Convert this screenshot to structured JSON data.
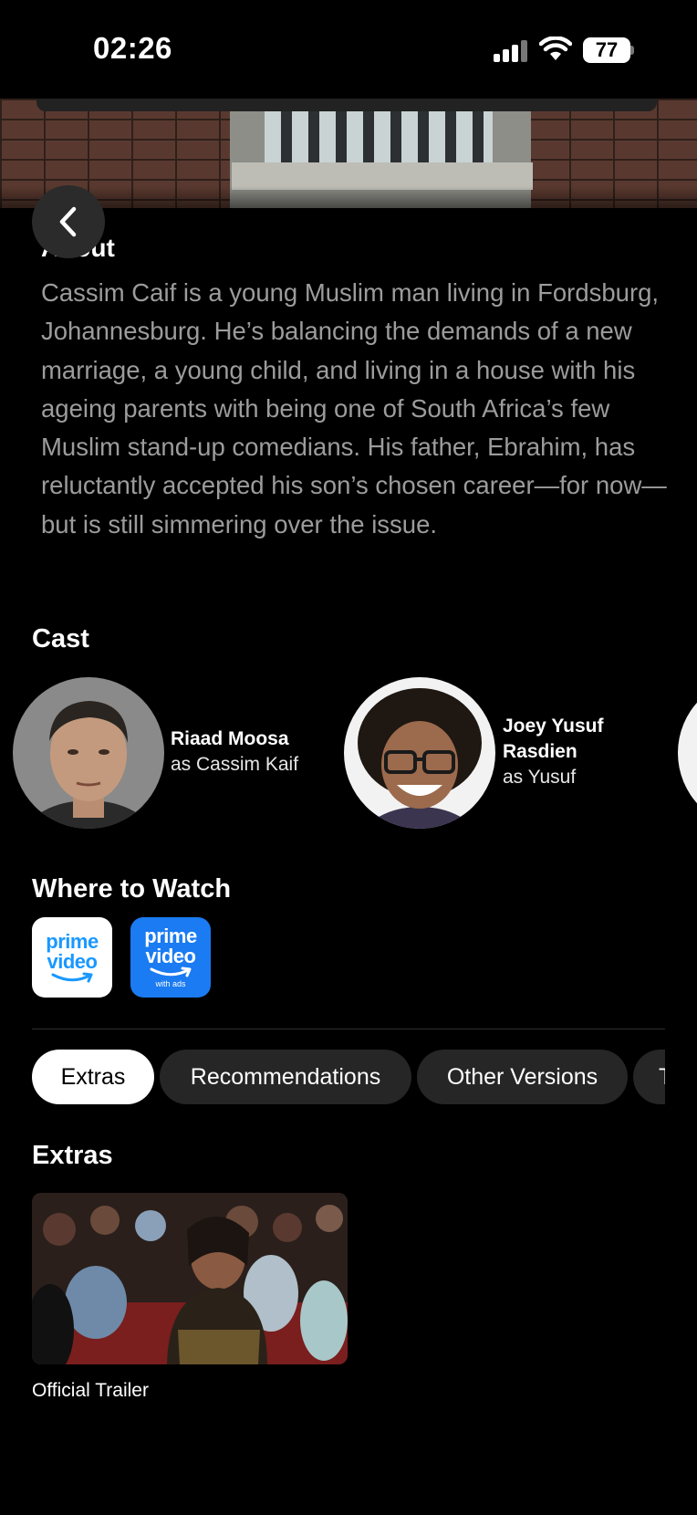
{
  "status_bar": {
    "time": "02:26",
    "battery": "77"
  },
  "about": {
    "title": "About",
    "text": "Cassim Caif is a young Muslim man living in Fordsburg, Johannesburg. He’s balancing the demands of a new marriage, a young child, and living in a house with his ageing parents with being one of South Africa’s few Muslim stand-up comedians. His father, Ebrahim, has reluctantly accepted his son’s chosen career—for now—but is still simmering over the issue."
  },
  "cast": {
    "title": "Cast",
    "members": [
      {
        "name": "Riaad Moosa",
        "role": "as Cassim Kaif"
      },
      {
        "name": "Joey Yusuf Rasdien",
        "name_lines": [
          "Joey Yusuf",
          "Rasdien"
        ],
        "role": "as Yusuf"
      }
    ]
  },
  "where_to_watch": {
    "title": "Where to Watch",
    "providers": [
      {
        "line1": "prime",
        "line2": "video",
        "sub": ""
      },
      {
        "line1": "prime",
        "line2": "video",
        "sub": "with ads"
      }
    ]
  },
  "tabs": [
    "Extras",
    "Recommendations",
    "Other Versions",
    "T"
  ],
  "extras": {
    "title": "Extras",
    "items": [
      {
        "label": "Official Trailer"
      }
    ]
  },
  "colors": {
    "background": "#000000",
    "provider_white": "#ffffff",
    "provider_blue": "#1a7bf2",
    "prime_blue": "#1a98ff"
  },
  "icons": [
    "cellular-signal-icon",
    "wifi-icon",
    "battery-icon",
    "chevron-left-icon",
    "amazon-smile-icon"
  ]
}
